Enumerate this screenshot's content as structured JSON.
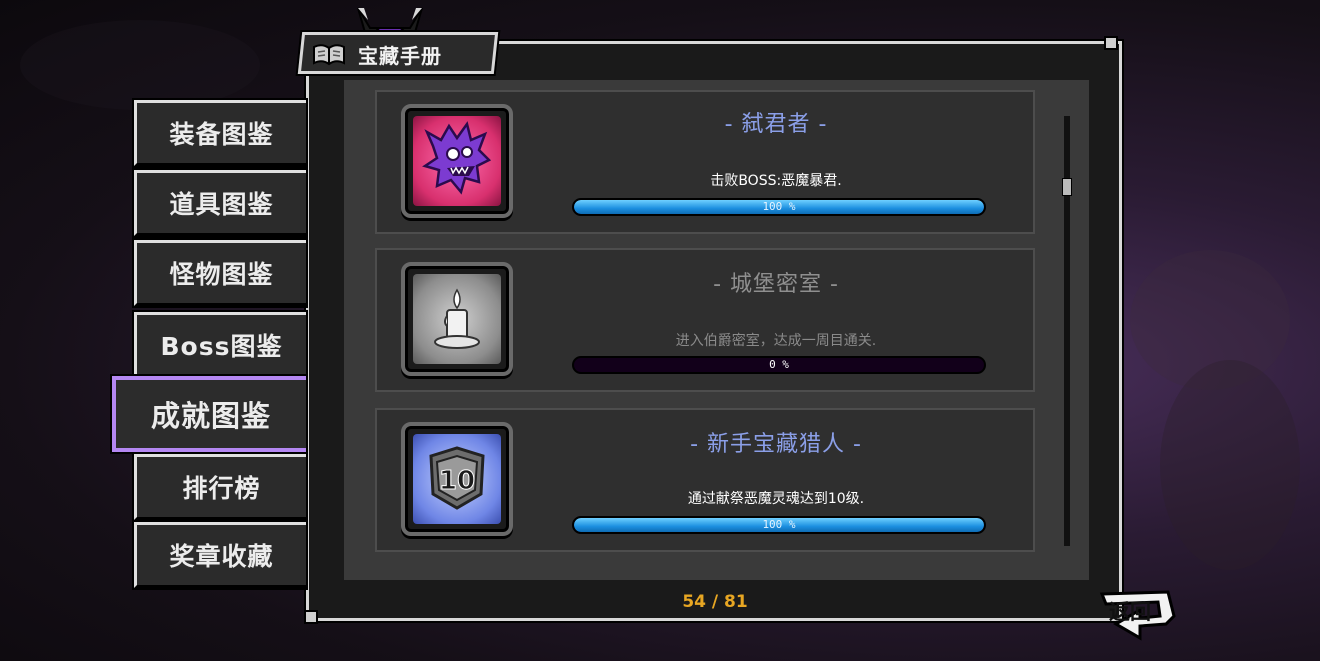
{
  "window": {
    "title": "宝藏手册",
    "page_counter": "54 / 81"
  },
  "menu": {
    "items": [
      {
        "label": "装备图鉴",
        "active": false
      },
      {
        "label": "道具图鉴",
        "active": false
      },
      {
        "label": "怪物图鉴",
        "active": false
      },
      {
        "label": "Boss图鉴",
        "active": false
      },
      {
        "label": "成就图鉴",
        "active": true
      },
      {
        "label": "排行榜",
        "active": false
      },
      {
        "label": "奖章收藏",
        "active": false
      }
    ]
  },
  "achievements": [
    {
      "name": "- 弑君者 -",
      "description": "击败BOSS:恶魔暴君.",
      "progress": 1.0,
      "progress_text": "100 %",
      "completed": true,
      "icon": "demon-tyrant-icon"
    },
    {
      "name": "- 城堡密室 -",
      "description": "进入伯爵密室，达成一周目通关.",
      "progress": 0.0,
      "progress_text": "0 %",
      "completed": false,
      "icon": "candle-icon"
    },
    {
      "name": "- 新手宝藏猎人 -",
      "description": "通过献祭恶魔灵魂达到10级.",
      "progress": 1.0,
      "progress_text": "100 %",
      "completed": true,
      "icon": "level-10-shield-icon"
    }
  ],
  "back_button": {
    "label": "返回"
  },
  "colors": {
    "active_menu_border": "#b487f2",
    "completed_title": "#8b9fe8",
    "progress_fill": "#1c8fe0",
    "page_counter": "#e7a623"
  }
}
